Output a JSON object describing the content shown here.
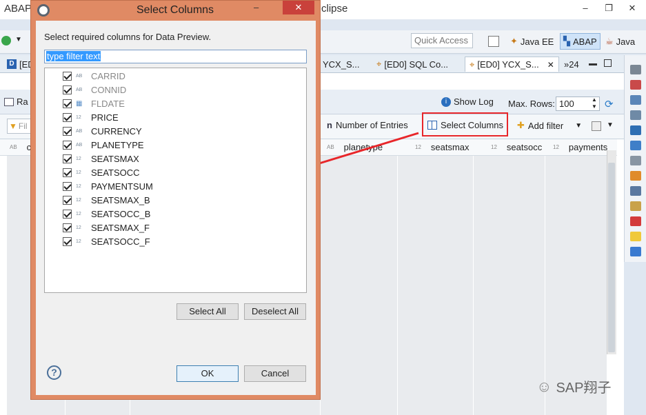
{
  "window": {
    "title_left": "ABAP",
    "title_right": "clipse",
    "controls": [
      "–",
      "❐",
      "✕"
    ]
  },
  "toolbar": {
    "quick_access_placeholder": "Quick Access",
    "perspectives": [
      "Java EE",
      "ABAP",
      "Java"
    ]
  },
  "editor_tabs": [
    {
      "label": "[ED"
    },
    {
      "label": "YCX_S..."
    },
    {
      "label": "[ED0] SQL Co..."
    },
    {
      "label": "[ED0] YCX_S..."
    },
    {
      "label": "»24"
    }
  ],
  "preview": {
    "raw_tab_label": "Ra",
    "show_log_label": "Show Log",
    "max_rows_label": "Max. Rows:",
    "max_rows_value": "100",
    "filter_placeholder": "Fil",
    "actions": {
      "number_of_entries": "Number of Entries",
      "select_columns": "Select Columns",
      "add_filter": "Add filter"
    },
    "columns": [
      {
        "type": "AB",
        "name": "c"
      },
      {
        "type": "AB",
        "name": "planetype"
      },
      {
        "type": "12",
        "name": "seatsmax"
      },
      {
        "type": "12",
        "name": "seatsocc"
      },
      {
        "type": "12",
        "name": "payments"
      }
    ]
  },
  "dialog": {
    "title": "Select Columns",
    "close_label": "✕",
    "minimize_label": "–",
    "instruction": "Select required columns for Data Preview.",
    "filter_text": "type filter text",
    "columns": [
      {
        "type": "AB",
        "name": "CARRID",
        "checked": true,
        "key": true
      },
      {
        "type": "AB",
        "name": "CONNID",
        "checked": true,
        "key": true
      },
      {
        "type": "▦",
        "name": "FLDATE",
        "checked": true,
        "key": true
      },
      {
        "type": "12",
        "name": "PRICE",
        "checked": true,
        "key": false
      },
      {
        "type": "AB",
        "name": "CURRENCY",
        "checked": true,
        "key": false
      },
      {
        "type": "AB",
        "name": "PLANETYPE",
        "checked": true,
        "key": false
      },
      {
        "type": "12",
        "name": "SEATSMAX",
        "checked": true,
        "key": false
      },
      {
        "type": "12",
        "name": "SEATSOCC",
        "checked": true,
        "key": false
      },
      {
        "type": "12",
        "name": "PAYMENTSUM",
        "checked": true,
        "key": false
      },
      {
        "type": "12",
        "name": "SEATSMAX_B",
        "checked": true,
        "key": false
      },
      {
        "type": "12",
        "name": "SEATSOCC_B",
        "checked": true,
        "key": false
      },
      {
        "type": "12",
        "name": "SEATSMAX_F",
        "checked": true,
        "key": false
      },
      {
        "type": "12",
        "name": "SEATSOCC_F",
        "checked": true,
        "key": false
      }
    ],
    "select_all": "Select All",
    "deselect_all": "Deselect All",
    "ok": "OK",
    "cancel": "Cancel",
    "help": "?"
  },
  "watermark": "SAP翔子",
  "colors": {
    "highlight": "#e8262a",
    "dialog_frame": "#e08a64",
    "close_button": "#c9413b"
  }
}
